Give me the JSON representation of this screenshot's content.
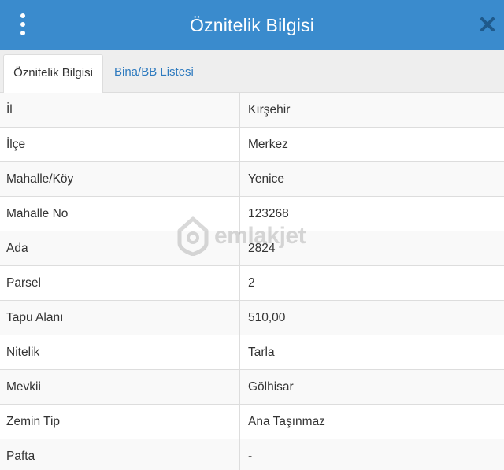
{
  "header": {
    "title": "Öznitelik Bilgisi",
    "menu_icon": "kebab-menu-icon",
    "close_icon": "close-icon"
  },
  "tabs": [
    {
      "label": "Öznitelik Bilgisi",
      "active": true
    },
    {
      "label": "Bina/BB Listesi",
      "active": false
    }
  ],
  "attributes": [
    {
      "label": "İl",
      "value": "Kırşehir"
    },
    {
      "label": "İlçe",
      "value": "Merkez"
    },
    {
      "label": "Mahalle/Köy",
      "value": "Yenice"
    },
    {
      "label": "Mahalle No",
      "value": "123268"
    },
    {
      "label": "Ada",
      "value": "2824"
    },
    {
      "label": "Parsel",
      "value": "2"
    },
    {
      "label": "Tapu Alanı",
      "value": "510,00"
    },
    {
      "label": "Nitelik",
      "value": "Tarla"
    },
    {
      "label": "Mevkii",
      "value": "Gölhisar"
    },
    {
      "label": "Zemin Tip",
      "value": "Ana Taşınmaz"
    },
    {
      "label": "Pafta",
      "value": "-"
    }
  ],
  "watermark": {
    "text": "emlakjet",
    "icon": "home-pin-logo"
  },
  "colors": {
    "header_bg": "#3a8bcd",
    "tab_link": "#2f7bbf",
    "row_stripe": "#f9f9f9",
    "border": "#dddddd"
  }
}
